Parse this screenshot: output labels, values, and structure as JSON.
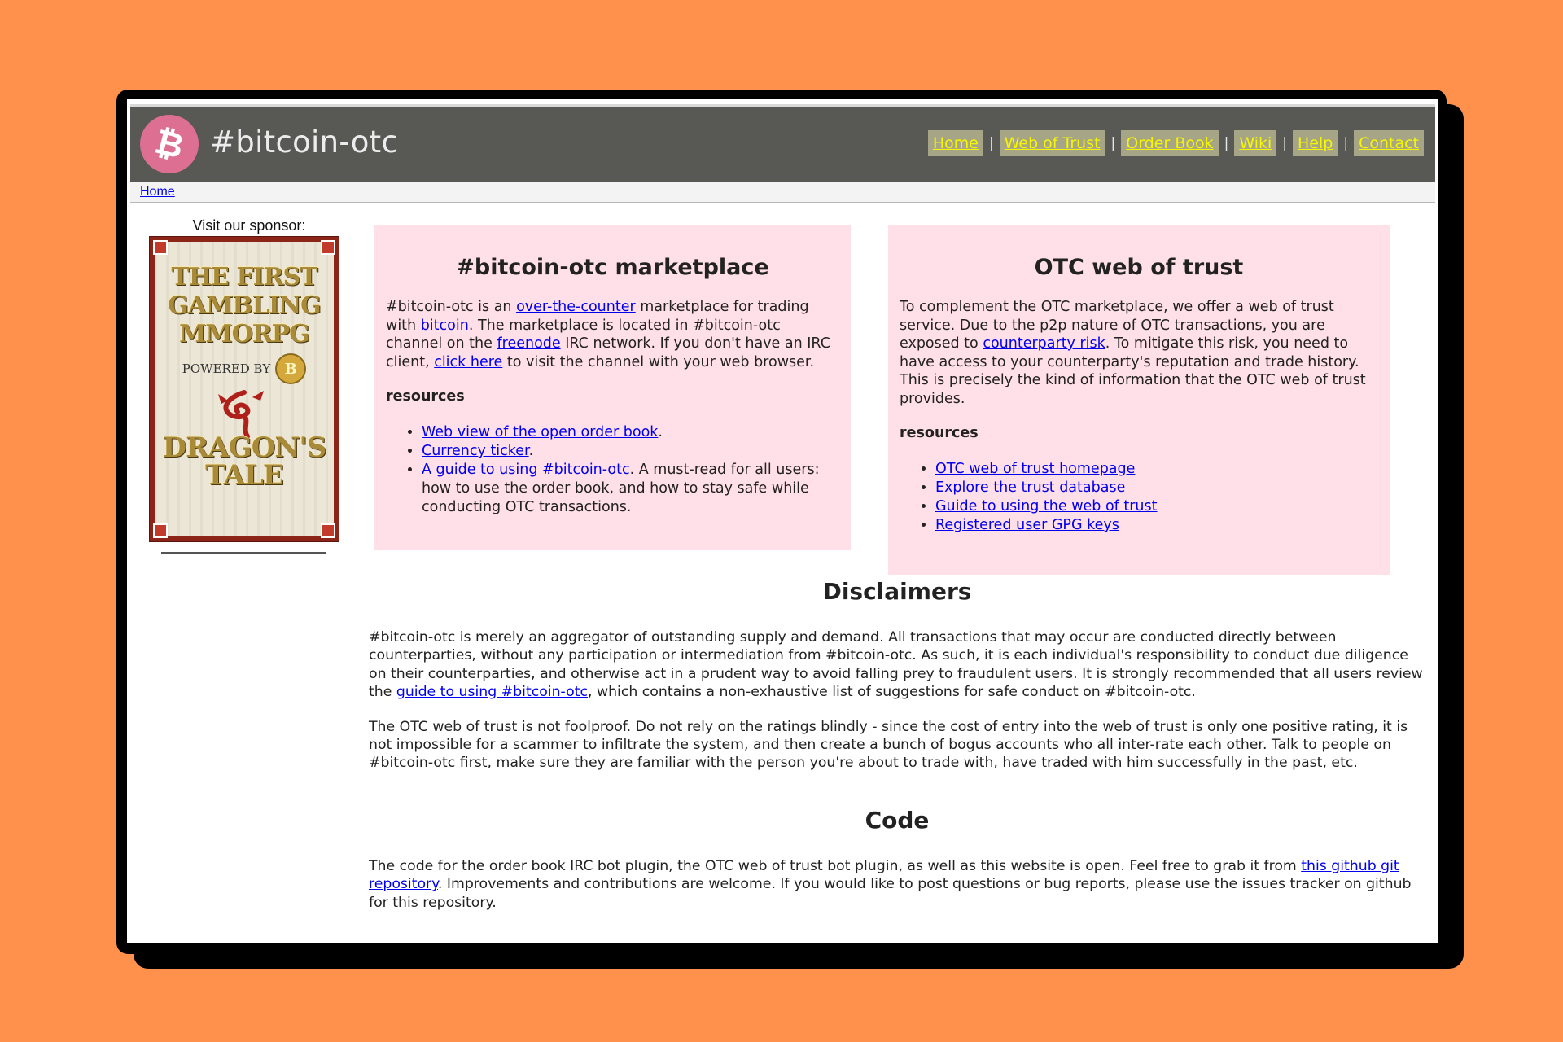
{
  "site": {
    "title": "#bitcoin-otc",
    "logo_symbol": "₿",
    "logo_color": "#dc6f92",
    "header_bg": "#585854",
    "background_color": "#ff914d"
  },
  "nav": {
    "home": "Home",
    "web_of_trust": "Web of Trust",
    "order_book": "Order Book",
    "wiki": "Wiki",
    "help": "Help",
    "contact": "Contact",
    "separator": "|"
  },
  "breadcrumb": {
    "home": "Home"
  },
  "sponsor": {
    "label": "Visit our sponsor:",
    "ad_line1": "THE FIRST",
    "ad_line2": "GAMBLING",
    "ad_line3": "MMORPG",
    "ad_powered": "POWERED BY",
    "ad_coin": "B",
    "ad_game_line1": "DRAGON'S",
    "ad_game_line2": "TALE"
  },
  "marketplace": {
    "title": "#bitcoin-otc marketplace",
    "p1": "#bitcoin-otc is an ",
    "link_otc": "over-the-counter",
    "p2": " marketplace for trading with ",
    "link_bitcoin": "bitcoin",
    "p3": ". The marketplace is located in #bitcoin-otc channel on the ",
    "link_freenode": "freenode",
    "p4": " IRC network. If you don't have an IRC client, ",
    "link_click": "click here",
    "p5": " to visit the channel with your web browser.",
    "resources_heading": "resources",
    "res1_link": "Web view of the open order book",
    "res1_after": ".",
    "res2_link": "Currency ticker",
    "res2_after": ".",
    "res3_link": "A guide to using #bitcoin-otc",
    "res3_after": ". A must-read for all users: how to use the order book, and how to stay safe while conducting OTC transactions."
  },
  "web_of_trust": {
    "title": "OTC web of trust",
    "p1": "To complement the OTC marketplace, we offer a web of trust service. Due to the p2p nature of OTC transactions, you are exposed to ",
    "link_risk": "counterparty risk",
    "p2": ". To mitigate this risk, you need to have access to your counterparty's reputation and trade history. This is precisely the kind of information that the OTC web of trust provides.",
    "resources_heading": "resources",
    "res1": "OTC web of trust homepage",
    "res2": "Explore the trust database",
    "res3": "Guide to using the web of trust",
    "res4": "Registered user GPG keys"
  },
  "disclaimers": {
    "title": "Disclaimers",
    "p1_before": "#bitcoin-otc is merely an aggregator of outstanding supply and demand. All transactions that may occur are conducted directly between counterparties, without any participation or intermediation from #bitcoin-otc. As such, it is each individual's responsibility to conduct due diligence on their counterparties, and otherwise act in a prudent way to avoid falling prey to fraudulent users. It is strongly recommended that all users review the ",
    "p1_link": "guide to using #bitcoin-otc",
    "p1_after": ", which contains a non-exhaustive list of suggestions for safe conduct on #bitcoin-otc.",
    "p2": "The OTC web of trust is not foolproof. Do not rely on the ratings blindly - since the cost of entry into the web of trust is only one positive rating, it is not impossible for a scammer to infiltrate the system, and then create a bunch of bogus accounts who all inter-rate each other. Talk to people on #bitcoin-otc first, make sure they are familiar with the person you're about to trade with, have traded with him successfully in the past, etc."
  },
  "code": {
    "title": "Code",
    "p_before": "The code for the order book IRC bot plugin, the OTC web of trust bot plugin, as well as this website is open. Feel free to grab it from ",
    "p_link": "this github git repository",
    "p_after": ". Improvements and contributions are welcome. If you would like to post questions or bug reports, please use the issues tracker on github for this repository."
  }
}
